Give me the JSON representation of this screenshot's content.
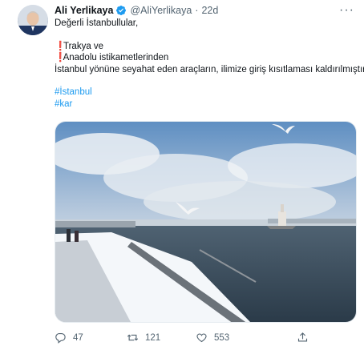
{
  "tweet": {
    "author_name": "Ali Yerlikaya",
    "handle": "@AliYerlikaya",
    "separator": "·",
    "time": "22d",
    "more_label": "···",
    "lines": {
      "greeting": "Değerli İstanbullular,",
      "item1_mark": "❗",
      "item1": "Trakya ve",
      "item2_mark": "❗",
      "item2": "Anadolu istikametlerinden",
      "statement": "İstanbul yönüne seyahat eden araçların, ilimize giriş kısıtlaması kaldırılmıştır."
    },
    "hashtags": [
      "#İstanbul",
      "#kar"
    ]
  },
  "actions": {
    "replies": "47",
    "retweets": "121",
    "likes": "553"
  },
  "colors": {
    "accent": "#1d9bf0",
    "secondary_text": "#536471",
    "exclamation": "#e0245e"
  },
  "icons": {
    "verified": "verified-badge-icon",
    "reply": "reply-icon",
    "retweet": "retweet-icon",
    "like": "heart-icon",
    "share": "share-icon",
    "more": "more-icon"
  }
}
